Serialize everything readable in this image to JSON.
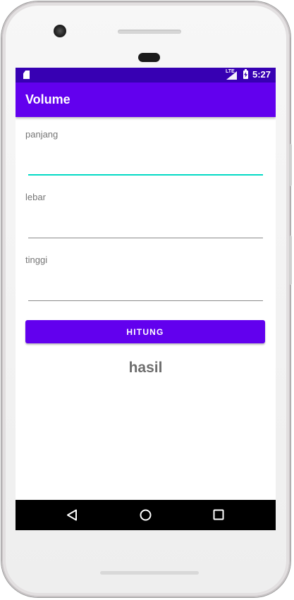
{
  "status_bar": {
    "network": "LTE",
    "time": "5:27"
  },
  "app_bar": {
    "title": "Volume"
  },
  "form": {
    "fields": [
      {
        "label": "panjang",
        "value": "",
        "focused": true
      },
      {
        "label": "lebar",
        "value": "",
        "focused": false
      },
      {
        "label": "tinggi",
        "value": "",
        "focused": false
      }
    ],
    "button_label": "HITUNG",
    "result_text": "hasil"
  },
  "nav_bar": {
    "buttons": [
      "back-icon",
      "home-icon",
      "recents-icon"
    ]
  },
  "colors": {
    "primary": "#6200ee",
    "primary_dark": "#3700b3",
    "accent": "#03dac5",
    "label": "#757575",
    "result": "#6d6d6d"
  }
}
